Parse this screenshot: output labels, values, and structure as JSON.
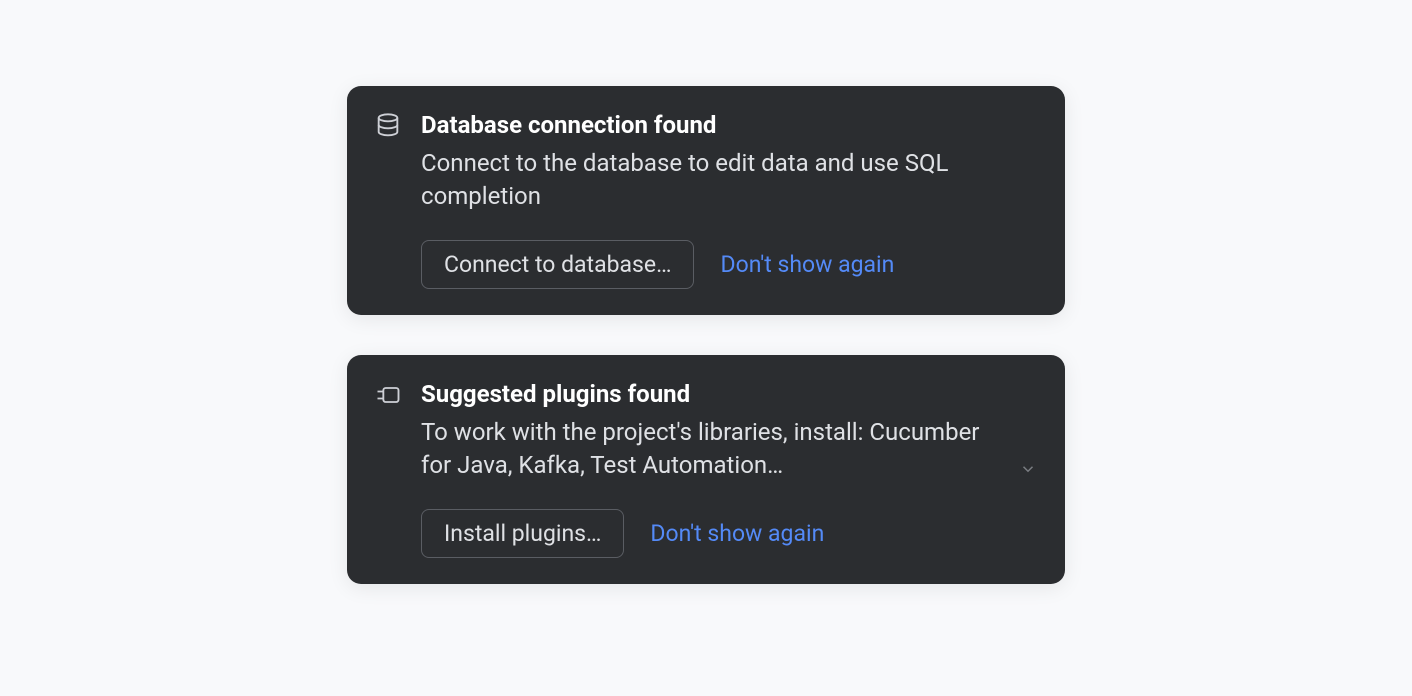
{
  "notifications": [
    {
      "icon": "database-icon",
      "title": "Database connection found",
      "description": "Connect to the database to edit data and use SQL completion",
      "primary_action": "Connect to database…",
      "secondary_action": "Don't show again",
      "expandable": false
    },
    {
      "icon": "plugin-icon",
      "title": "Suggested plugins found",
      "description": "To work with the project's libraries, install: Cucumber for Java, Kafka, Test Automation…",
      "primary_action": "Install plugins…",
      "secondary_action": "Don't show again",
      "expandable": true
    }
  ]
}
